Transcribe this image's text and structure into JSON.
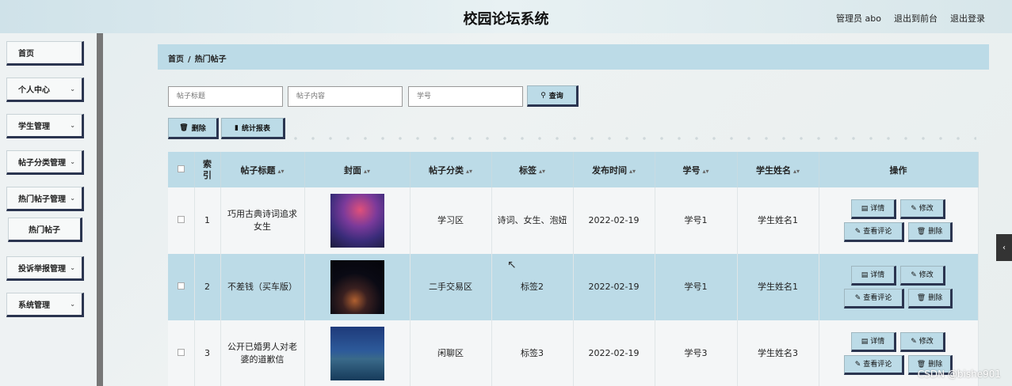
{
  "header": {
    "title": "校园论坛系统",
    "user": "管理员 abo",
    "to_front": "退出到前台",
    "logout": "退出登录"
  },
  "sidebar": {
    "items": [
      {
        "label": "首页"
      },
      {
        "label": "个人中心"
      },
      {
        "label": "学生管理"
      },
      {
        "label": "帖子分类管理"
      },
      {
        "label": "热门帖子管理"
      },
      {
        "label": "热门帖子"
      },
      {
        "label": "投诉举报管理"
      },
      {
        "label": "系统管理"
      }
    ]
  },
  "breadcrumb": {
    "home": "首页",
    "sep": "/",
    "current": "热门帖子"
  },
  "search": {
    "title_placeholder": "帖子标题",
    "content_placeholder": "帖子内容",
    "student_no_placeholder": "学号",
    "query_label": "查询",
    "query_icon": "search-icon"
  },
  "toolbar": {
    "delete_label": "删除",
    "delete_icon": "trash-icon",
    "report_label": "统计报表",
    "report_icon": "bar-chart-icon"
  },
  "table": {
    "headers": {
      "index": "索引",
      "title": "帖子标题",
      "cover": "封面",
      "category": "帖子分类",
      "tags": "标签",
      "publish_time": "发布时间",
      "student_no": "学号",
      "student_name": "学生姓名",
      "actions": "操作"
    },
    "rows": [
      {
        "index": "1",
        "title": "巧用古典诗词追求女生",
        "category": "学习区",
        "tags": "诗词、女生、泡妞",
        "publish_time": "2022-02-19",
        "student_no": "学号1",
        "student_name": "学生姓名1"
      },
      {
        "index": "2",
        "title": "不差钱（买车版）",
        "category": "二手交易区",
        "tags": "标签2",
        "publish_time": "2022-02-19",
        "student_no": "学号1",
        "student_name": "学生姓名1"
      },
      {
        "index": "3",
        "title": "公开已婚男人对老婆的道歉信",
        "category": "闲聊区",
        "tags": "标签3",
        "publish_time": "2022-02-19",
        "student_no": "学号3",
        "student_name": "学生姓名3"
      }
    ],
    "actions": {
      "detail": "详情",
      "edit": "修改",
      "view_comments": "查看评论",
      "delete": "删除"
    }
  },
  "watermark": "CSDN @bishe901",
  "colors": {
    "accent": "#bcdbe7",
    "button_border": "#2b3550"
  }
}
